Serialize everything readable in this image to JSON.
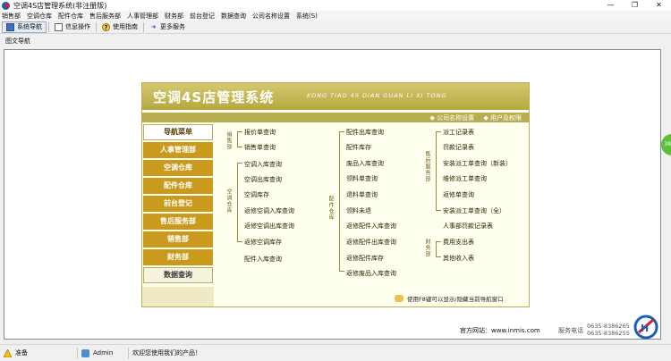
{
  "window": {
    "title": "空调4S店管理系统(非注册版)",
    "controls": [
      "—",
      "❐",
      "✕"
    ]
  },
  "menubar": [
    "销售部",
    "空调仓库",
    "配件仓库",
    "售后服务部",
    "人事管理部",
    "财务部",
    "前台登记",
    "数据查询",
    "公司名称设置",
    "系统(S)"
  ],
  "toolbar": [
    {
      "label": "系统导航",
      "icon": "nav-window-icon",
      "active": true
    },
    {
      "label": "信息操作",
      "icon": "info-window-icon",
      "active": false
    },
    {
      "label": "使用指南",
      "icon": "help-icon",
      "active": false
    },
    {
      "label": "更多服务",
      "icon": "more-services-icon",
      "active": false
    }
  ],
  "doc_tab": "图文导航",
  "nav_panel": {
    "title": "空调4S店管理系统",
    "pinyin": "KONG TIAO  4S DIAN GUAN LI XI TONG",
    "links": [
      "◆ 公司名称设置",
      "◆ 用户及权限"
    ],
    "menu_title": "导航菜单",
    "menu": [
      "人事管理部",
      "空调仓库",
      "配件仓库",
      "前台登记",
      "售后服务部",
      "销售部",
      "财务部",
      "数据查询"
    ],
    "groups": {
      "sales": {
        "label": "销售部",
        "items": [
          "报价单查询",
          "销售单查询"
        ]
      },
      "ac_warehouse": {
        "label": "空调仓库",
        "items": [
          "空调入库查询",
          "空调出库查询",
          "空调库存",
          "返修空调入库查询",
          "返修空调出库查询",
          "返修空调库存",
          "配件入库查询"
        ]
      },
      "parts_warehouse": {
        "label": "配件仓库",
        "items": [
          "配件出库查询",
          "配件库存",
          "废品入库查询",
          "领料单查询",
          "退料单查询",
          "领料未退",
          "返修配件入库查询",
          "返修配件出库查询",
          "返修配件库存",
          "返修废品入库查询"
        ]
      },
      "after_sales": {
        "label": "售后服务部",
        "items": [
          "派工记录表",
          "罚款记录表",
          "安装派工单查询（新装）",
          "维修派工单查询",
          "返修单查询",
          "安装派工单查询（全）",
          "人事部罚款记录表"
        ]
      },
      "finance": {
        "label": "财务部",
        "items": [
          "费用支出表",
          "其他收入表"
        ]
      }
    },
    "footer": "使用F8键可以显示/隐藏当前导航窗口"
  },
  "website": {
    "label": "官方网站：",
    "url": "www.inmis.com"
  },
  "phone": {
    "label": "服务电话",
    "numbers": [
      "0635-8386265",
      "0635-8386255"
    ]
  },
  "side_bubble": "38",
  "statusbar": {
    "ready": "准备",
    "user": "Admin",
    "welcome": "欢迎您使用我们的产品！"
  },
  "colors": {
    "gold": "#c99a1d",
    "header": "#c7bb55",
    "panel_bg": "#fffff0"
  }
}
